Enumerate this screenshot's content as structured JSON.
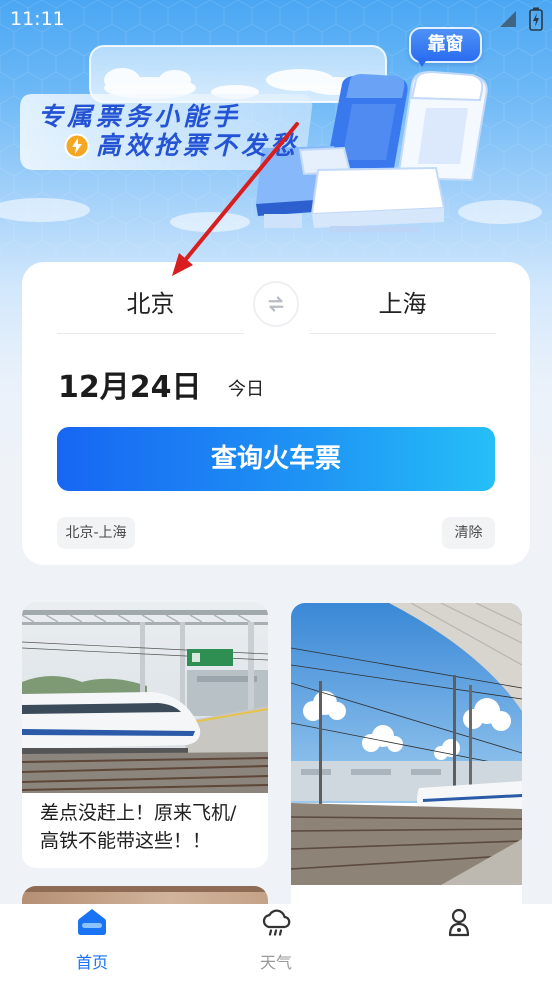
{
  "status_bar": {
    "time": "11:11",
    "icons": [
      "signal-icon",
      "battery-charging-icon"
    ]
  },
  "banner": {
    "headline": "专属票务小能手",
    "subline": "高效抢票不发愁",
    "subline_icon": "lightning-icon",
    "badge": "靠窗",
    "illustration": "train-seats-illustration"
  },
  "search": {
    "from_city": "北京",
    "to_city": "上海",
    "swap_icon": "swap-arrows-icon",
    "date": "12月24日",
    "date_hint": "今日",
    "submit_label": "查询火车票",
    "history": [
      {
        "label": "北京-上海"
      }
    ],
    "clear_label": "清除"
  },
  "feed": {
    "left": [
      {
        "title": "差点没赶上！原来飞机/高铁不能带这些！！",
        "image": "train-platform-photo"
      },
      {
        "image": "photo"
      }
    ],
    "right": [
      {
        "image": "train-blue-sky-photo"
      }
    ]
  },
  "tabbar": {
    "items": [
      {
        "label": "首页",
        "icon": "home-icon",
        "active": true
      },
      {
        "label": "天气",
        "icon": "cloud-rain-icon",
        "active": false
      },
      {
        "icon": "user-icon",
        "active": false
      }
    ]
  },
  "colors": {
    "primary": "#1a73f5",
    "button_gradient_start": "#1766f2",
    "button_gradient_end": "#25bff7",
    "banner_text": "#2453d4",
    "tab_active": "#1a73f5",
    "tab_inactive": "#999999",
    "annotation_arrow": "#d81e1e"
  }
}
